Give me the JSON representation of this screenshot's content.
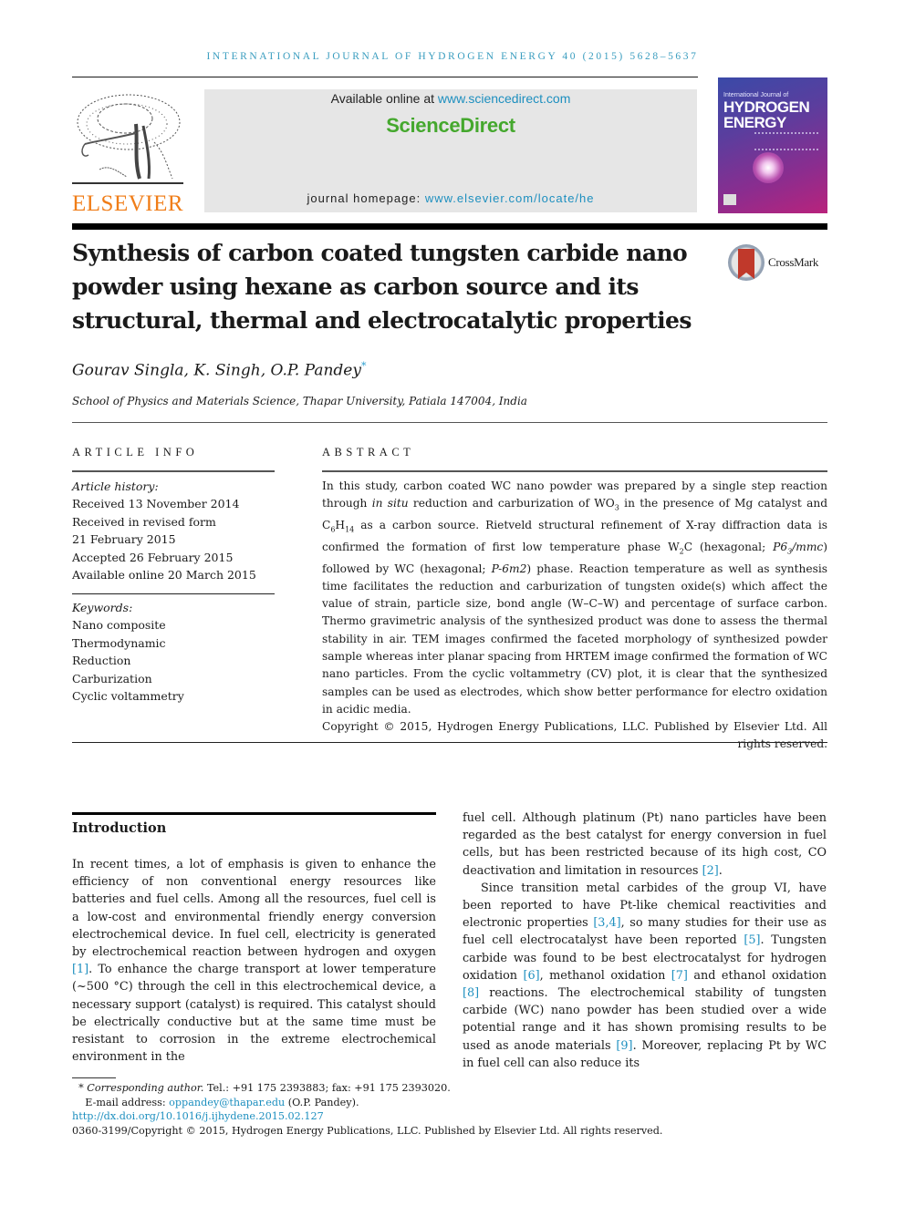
{
  "running_head": "INTERNATIONAL JOURNAL OF HYDROGEN ENERGY 40 (2015) 5628–5637",
  "publisher": {
    "name": "ELSEVIER",
    "logo_icon": "elsevier-tree-icon",
    "brand_color": "#f07d18"
  },
  "sciencedirect": {
    "available_prefix": "Available online at ",
    "available_link": "www.sciencedirect.com",
    "brand": "ScienceDirect",
    "brand_color": "#45a82e",
    "homepage_prefix": "journal homepage: ",
    "homepage_link": "www.elsevier.com/locate/he"
  },
  "journal_cover": {
    "small_title": "International Journal of",
    "line1": "HYDROGEN",
    "line2": "ENERGY"
  },
  "article": {
    "title": "Synthesis of carbon coated tungsten carbide nano powder using hexane as carbon source and its structural, thermal and electrocatalytic properties",
    "crossmark_label": "CrossMark",
    "authors": "Gourav Singla, K. Singh, O.P. Pandey",
    "author_mark": "*",
    "affiliation": "School of Physics and Materials Science, Thapar University, Patiala 147004, India"
  },
  "article_info": {
    "heading": "ARTICLE INFO",
    "history_label": "Article history:",
    "history": [
      "Received 13 November 2014",
      "Received in revised form",
      "21 February 2015",
      "Accepted 26 February 2015",
      "Available online 20 March 2015"
    ],
    "keywords_label": "Keywords:",
    "keywords": [
      "Nano composite",
      "Thermodynamic",
      "Reduction",
      "Carburization",
      "Cyclic voltammetry"
    ]
  },
  "abstract": {
    "heading": "ABSTRACT",
    "s1": "In this study, carbon coated WC nano powder was prepared by a single step reaction through ",
    "s1_ital": "in situ",
    "s2": " reduction and carburization of WO",
    "s2_sub": "3",
    "s3": " in the presence of Mg catalyst and C",
    "s3_sub1": "6",
    "s3_mid": "H",
    "s3_sub2": "14",
    "s4": " as a carbon source. Rietveld structural refinement of X-ray diffraction data is confirmed the formation of first low temperature phase W",
    "s4_sub": "2",
    "s5": "C (hexagonal; ",
    "s5_ital": "P6",
    "s5_sub": "3",
    "s5_ital2": "/mmc",
    "s6": ") followed by WC (hexagonal; ",
    "s6_ital": "P-6m2",
    "s7": ") phase. Reaction temperature as well as synthesis time facilitates the reduction and carburization of tungsten oxide(s) which affect the value of strain, particle size, bond angle (W–C–W) and percentage of surface carbon. Thermo gravimetric analysis of the synthesized product was done to assess the thermal stability in air. TEM images confirmed the faceted morphology of synthesized powder sample whereas inter planar spacing from HRTEM image confirmed the formation of WC nano particles. From the cyclic voltammetry (CV) plot, it is clear that the synthesized samples can be used as electrodes, which show better performance for electro oxidation in acidic media.",
    "copyright": "Copyright © 2015, Hydrogen Energy Publications, LLC. Published by Elsevier Ltd. All rights reserved."
  },
  "introduction": {
    "heading": "Introduction",
    "left_p1_a": "In recent times, a lot of emphasis is given to enhance the efficiency of non conventional energy resources like batteries and fuel cells. Among all the resources, fuel cell is a low-cost and environmental friendly energy conversion electrochemical device. In fuel cell, electricity is generated by electrochemical reaction between hydrogen and oxygen ",
    "ref1": "[1]",
    "left_p1_b": ". To enhance the charge transport at lower temperature (~500 °C) through the cell in this electrochemical device, a necessary support (catalyst) is required. This catalyst should be electrically conductive but at the same time must be resistant to corrosion in the extreme electrochemical environment in the",
    "right_p1_a": "fuel cell. Although platinum (Pt) nano particles have been regarded as the best catalyst for energy conversion in fuel cells, but has been restricted because of its high cost, CO deactivation and limitation in resources ",
    "ref2": "[2]",
    "right_p1_b": ".",
    "right_p2_a": "Since transition metal carbides of the group VI, have been reported to have Pt-like chemical reactivities and electronic properties ",
    "ref3": "[3,4]",
    "right_p2_b": ", so many studies for their use as fuel cell electrocatalyst have been reported ",
    "ref5": "[5]",
    "right_p2_c": ". Tungsten carbide was found to be best electrocatalyst for hydrogen oxidation ",
    "ref6": "[6]",
    "right_p2_d": ", methanol oxidation ",
    "ref7": "[7]",
    "right_p2_e": " and ethanol oxidation ",
    "ref8": "[8]",
    "right_p2_f": " reactions. The electrochemical stability of tungsten carbide (WC) nano powder has been studied over a wide potential range and it has shown promising results to be used as anode materials ",
    "ref9": "[9]",
    "right_p2_g": ". Moreover, replacing Pt by WC in fuel cell can also reduce its"
  },
  "footnotes": {
    "mark": "*",
    "corresponding_label": "Corresponding author.",
    "contact": " Tel.: +91 175 2393883; fax: +91 175 2393020.",
    "email_label": "E-mail address: ",
    "email": "oppandey@thapar.edu",
    "email_owner": " (O.P. Pandey).",
    "doi": "http://dx.doi.org/10.1016/j.ijhydene.2015.02.127",
    "issn_copyright": "0360-3199/Copyright © 2015, Hydrogen Energy Publications, LLC. Published by Elsevier Ltd. All rights reserved."
  },
  "colors": {
    "link": "#1d8fbf",
    "running_head": "#3a9dbf"
  }
}
